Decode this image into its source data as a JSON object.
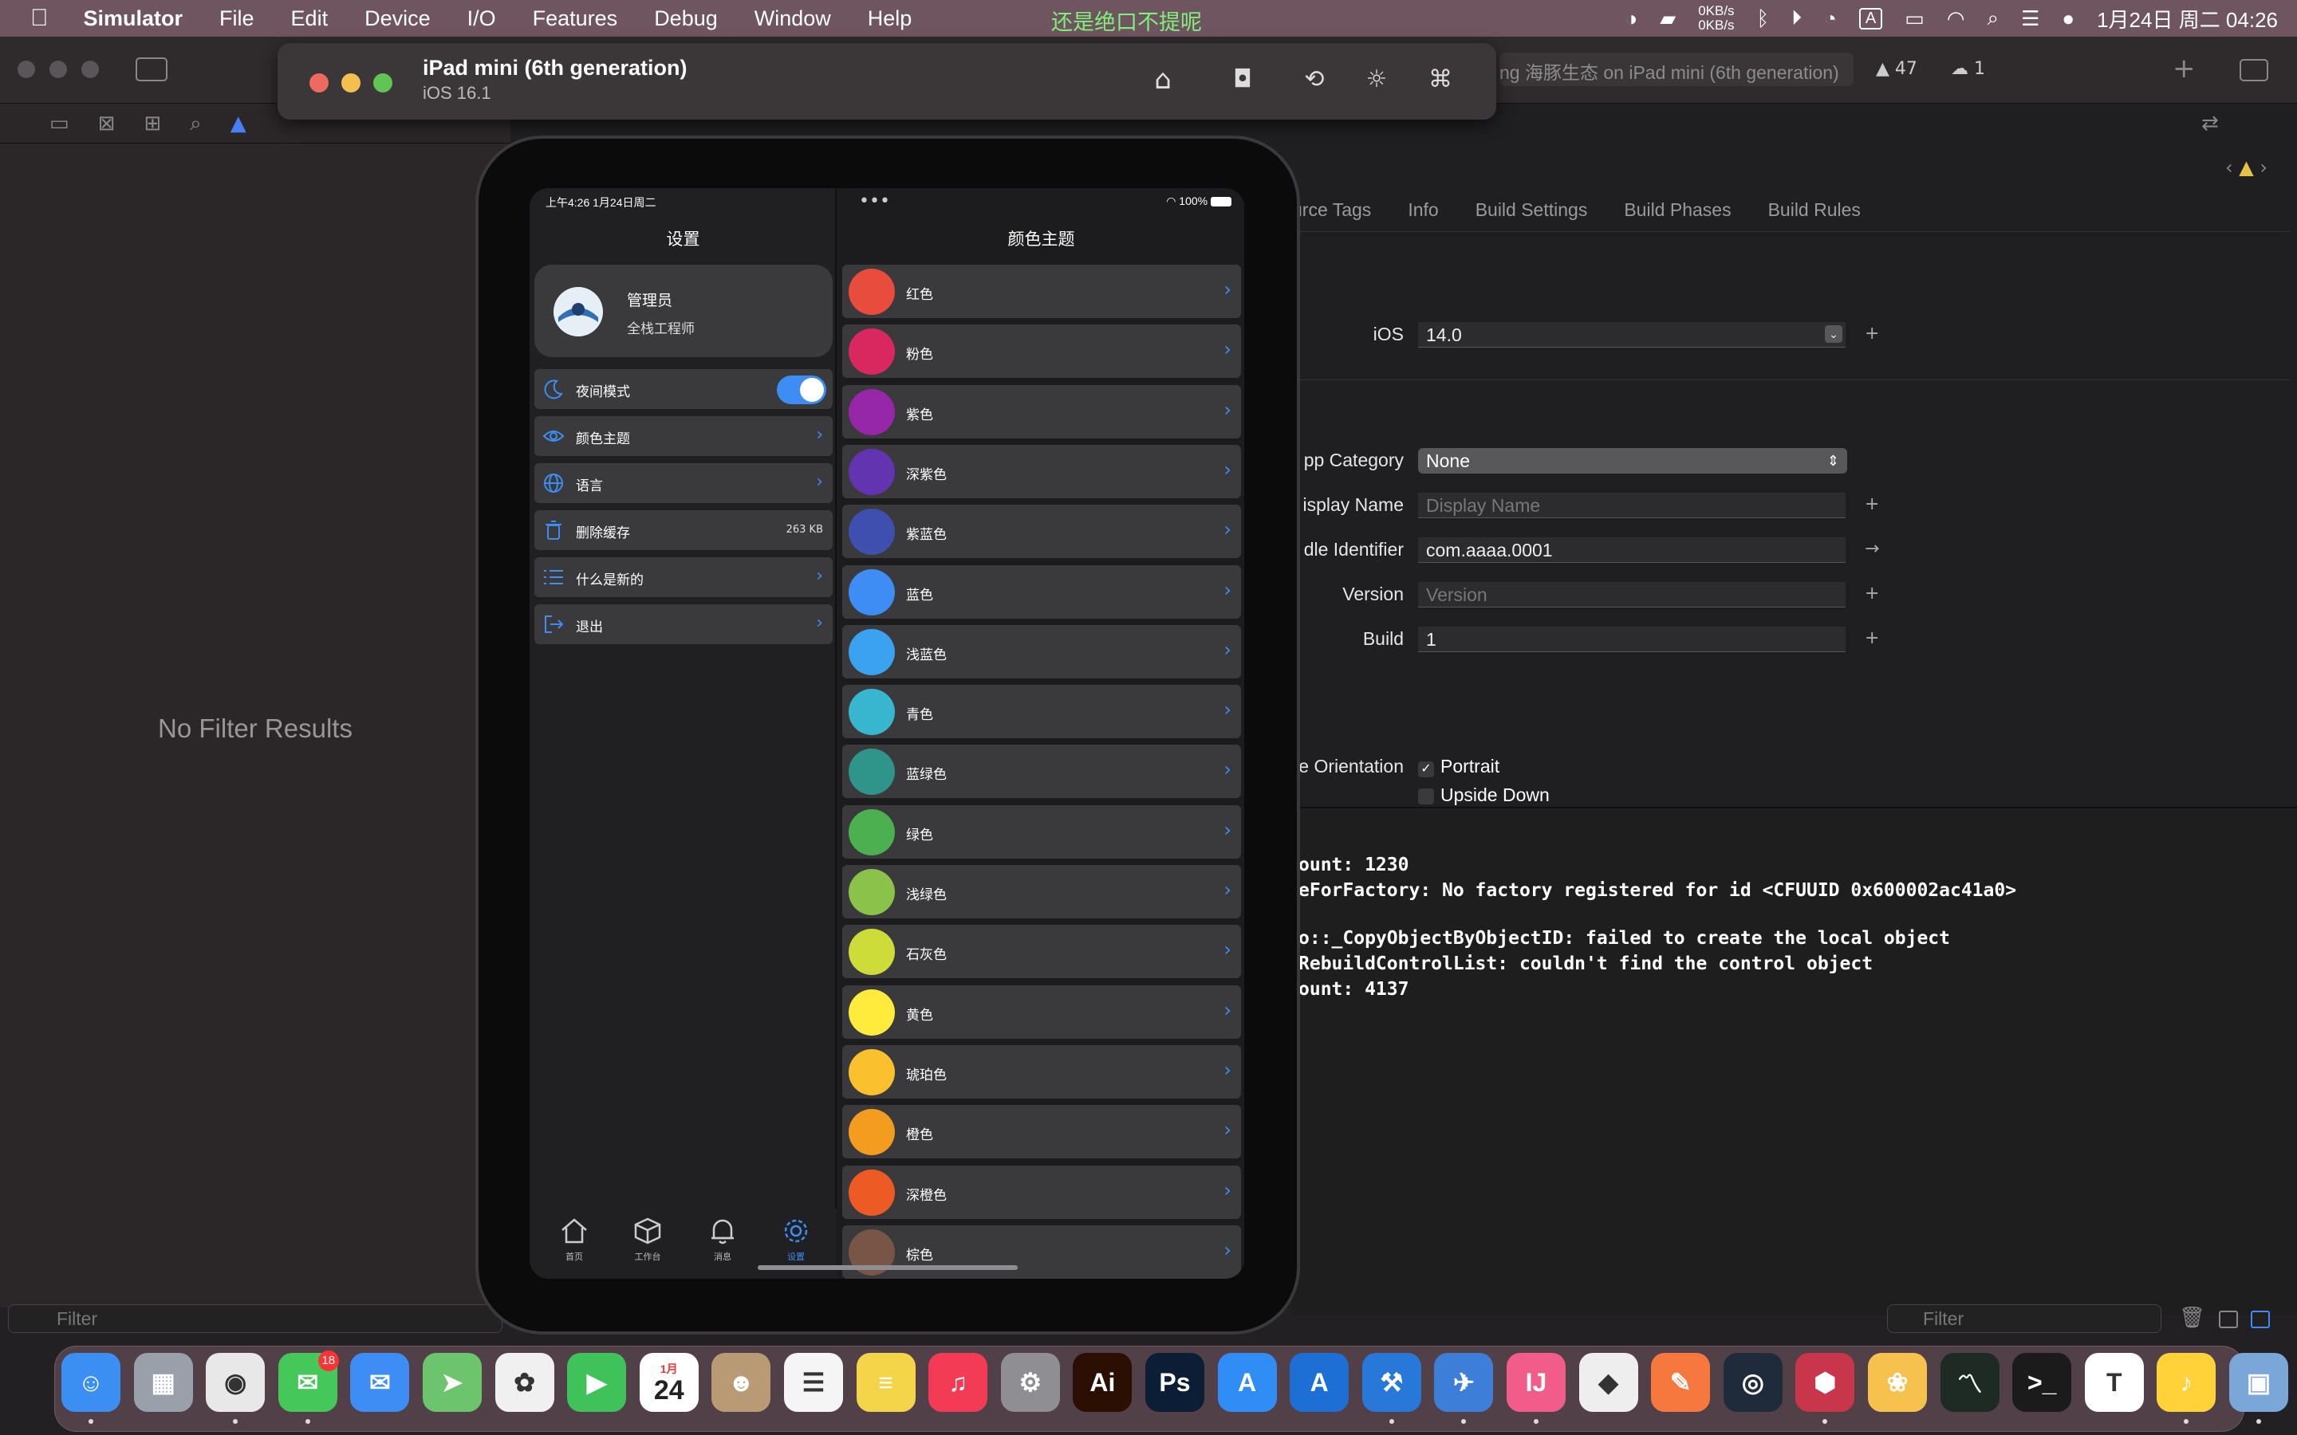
{
  "menubar": {
    "apple": "",
    "app_name": "Simulator",
    "items": [
      "File",
      "Edit",
      "Device",
      "I/O",
      "Features",
      "Debug",
      "Window",
      "Help"
    ],
    "ticker": "还是绝口不提呢",
    "net_up": "0KB/s",
    "net_down": "0KB/s",
    "datetime": "1月24日 周二  04:26"
  },
  "xcode": {
    "no_filter": "No Filter Results",
    "filter_placeholder": "Filter",
    "scheme_status": "ng 海豚生态 on iPad mini (6th generation)",
    "warnings": "47",
    "issues": "1",
    "tabs": [
      "urce Tags",
      "Info",
      "Build Settings",
      "Build Phases",
      "Build Rules"
    ],
    "ios_label": "iOS",
    "ios_value": "14.0",
    "app_category_label": "pp Category",
    "app_category_value": "None",
    "display_name_label": "isplay Name",
    "display_name_placeholder": "Display Name",
    "bundle_id_label": "dle Identifier",
    "bundle_id_value": "com.aaaa.0001",
    "version_label": "Version",
    "version_placeholder": "Version",
    "build_label": "Build",
    "build_value": "1",
    "orientation_label": "e Orientation",
    "portrait": "Portrait",
    "upside_down": "Upside Down",
    "console": [
      "ount: 1230",
      "eForFactory: No factory registered for id <CFUUID 0x600002ac41a0>",
      "",
      "o::_CopyObjectByObjectID: failed to create the local object",
      "RebuildControlList: couldn't find the control object",
      "ount: 4137"
    ]
  },
  "simulator": {
    "device": "iPad mini (6th generation)",
    "os": "iOS 16.1"
  },
  "ipad": {
    "status_time": "上午4:26  1月24日周二",
    "status_battery": "100%",
    "settings_title": "设置",
    "profile_name": "管理员",
    "profile_role": "全栈工程师",
    "settings_rows": [
      {
        "label": "夜间模式",
        "type": "toggle",
        "on": true,
        "icon": "moon-icon"
      },
      {
        "label": "颜色主题",
        "type": "chevron",
        "icon": "eye-icon"
      },
      {
        "label": "语言",
        "type": "chevron",
        "icon": "globe-icon"
      },
      {
        "label": "删除缓存",
        "type": "value",
        "value": "263 KB",
        "icon": "trash-icon"
      },
      {
        "label": "什么是新的",
        "type": "chevron",
        "icon": "list-icon"
      },
      {
        "label": "退出",
        "type": "chevron",
        "icon": "logout-icon"
      }
    ],
    "detail_title": "颜色主题",
    "colors": [
      {
        "name": "红色",
        "color": "#e74c3c"
      },
      {
        "name": "粉色",
        "color": "#d9285f"
      },
      {
        "name": "紫色",
        "color": "#9527a8"
      },
      {
        "name": "深紫色",
        "color": "#6234b0"
      },
      {
        "name": "紫蓝色",
        "color": "#3f4fb0"
      },
      {
        "name": "蓝色",
        "color": "#3d8df5"
      },
      {
        "name": "浅蓝色",
        "color": "#3aa2f0"
      },
      {
        "name": "青色",
        "color": "#38b6d0"
      },
      {
        "name": "蓝绿色",
        "color": "#2f948a"
      },
      {
        "name": "绿色",
        "color": "#4caf50"
      },
      {
        "name": "浅绿色",
        "color": "#8bc34a"
      },
      {
        "name": "石灰色",
        "color": "#cddc39"
      },
      {
        "name": "黄色",
        "color": "#ffeb3b"
      },
      {
        "name": "琥珀色",
        "color": "#fbc02d"
      },
      {
        "name": "橙色",
        "color": "#f39c1f"
      },
      {
        "name": "深橙色",
        "color": "#ee5a24"
      },
      {
        "name": "棕色",
        "color": "#795548"
      }
    ],
    "tabs": [
      {
        "label": "首页",
        "icon": "house-icon"
      },
      {
        "label": "工作台",
        "icon": "cube-icon"
      },
      {
        "label": "消息",
        "icon": "bell-icon"
      },
      {
        "label": "设置",
        "icon": "gear-icon",
        "active": true
      }
    ],
    "accent": "#3d8df5"
  },
  "dock": {
    "messages_badge": "18",
    "calendar_month": "1月",
    "calendar_day": "24"
  }
}
